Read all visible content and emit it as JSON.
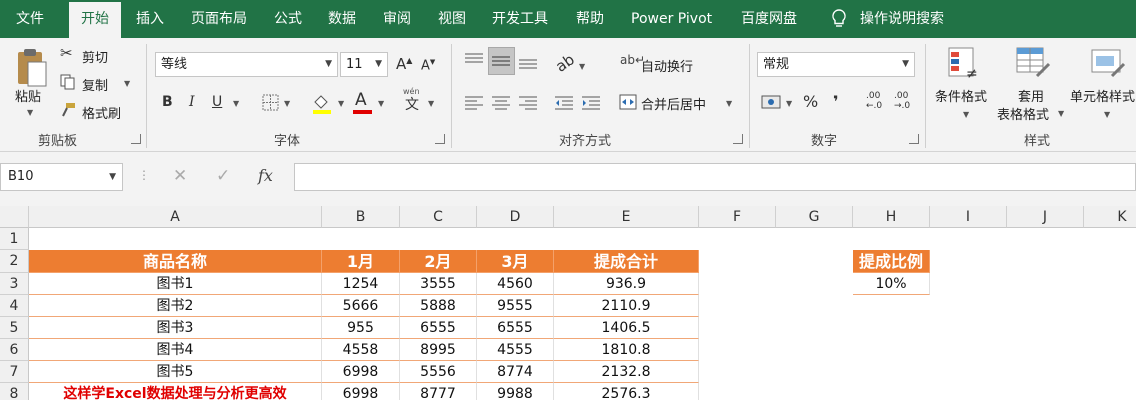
{
  "tabs": [
    "文件",
    "开始",
    "插入",
    "页面布局",
    "公式",
    "数据",
    "审阅",
    "视图",
    "开发工具",
    "帮助",
    "Power Pivot",
    "百度网盘"
  ],
  "active_tab": "开始",
  "search_label": "操作说明搜索",
  "clipboard": {
    "paste": "粘贴",
    "cut": "剪切",
    "copy": "复制",
    "format_painter": "格式刷",
    "group": "剪贴板"
  },
  "font": {
    "name": "等线",
    "size": "11",
    "group": "字体",
    "bold": "B",
    "italic": "I",
    "underline": "U",
    "grow": "A",
    "shrink": "A",
    "font_color_letter": "A",
    "phonetic": "wén"
  },
  "alignment": {
    "wrap": "自动换行",
    "merge": "合并后居中",
    "group": "对齐方式"
  },
  "number": {
    "format": "常规",
    "group": "数字",
    "percent": "%",
    "comma": "❜",
    "inc_decimal": ".00",
    "dec_decimal": ".00"
  },
  "styles": {
    "conditional": "条件格式",
    "table_1": "套用",
    "table_2": "表格格式",
    "cell": "单元格样式",
    "group": "样式"
  },
  "name_box": "B10",
  "fx": "fx",
  "columns": [
    "A",
    "B",
    "C",
    "D",
    "E",
    "F",
    "G",
    "H",
    "I",
    "J",
    "K"
  ],
  "rows": [
    "1",
    "2",
    "3",
    "4",
    "5",
    "6",
    "7",
    "8"
  ],
  "table": {
    "headers": [
      "商品名称",
      "1月",
      "2月",
      "3月",
      "提成合计"
    ],
    "rows": [
      [
        "图书1",
        "1254",
        "3555",
        "4560",
        "936.9"
      ],
      [
        "图书2",
        "5666",
        "5888",
        "9555",
        "2110.9"
      ],
      [
        "图书3",
        "955",
        "6555",
        "6555",
        "1406.5"
      ],
      [
        "图书4",
        "4558",
        "8995",
        "4555",
        "1810.8"
      ],
      [
        "图书5",
        "6998",
        "5556",
        "8774",
        "2132.8"
      ],
      [
        "这样学Excel数据处理与分析更高效",
        "6998",
        "8777",
        "9988",
        "2576.3"
      ]
    ]
  },
  "commission": {
    "header": "提成比例",
    "value": "10%"
  },
  "colors": {
    "accent": "#217346",
    "header_fill": "#ed7d31",
    "red_text": "#e00000"
  }
}
